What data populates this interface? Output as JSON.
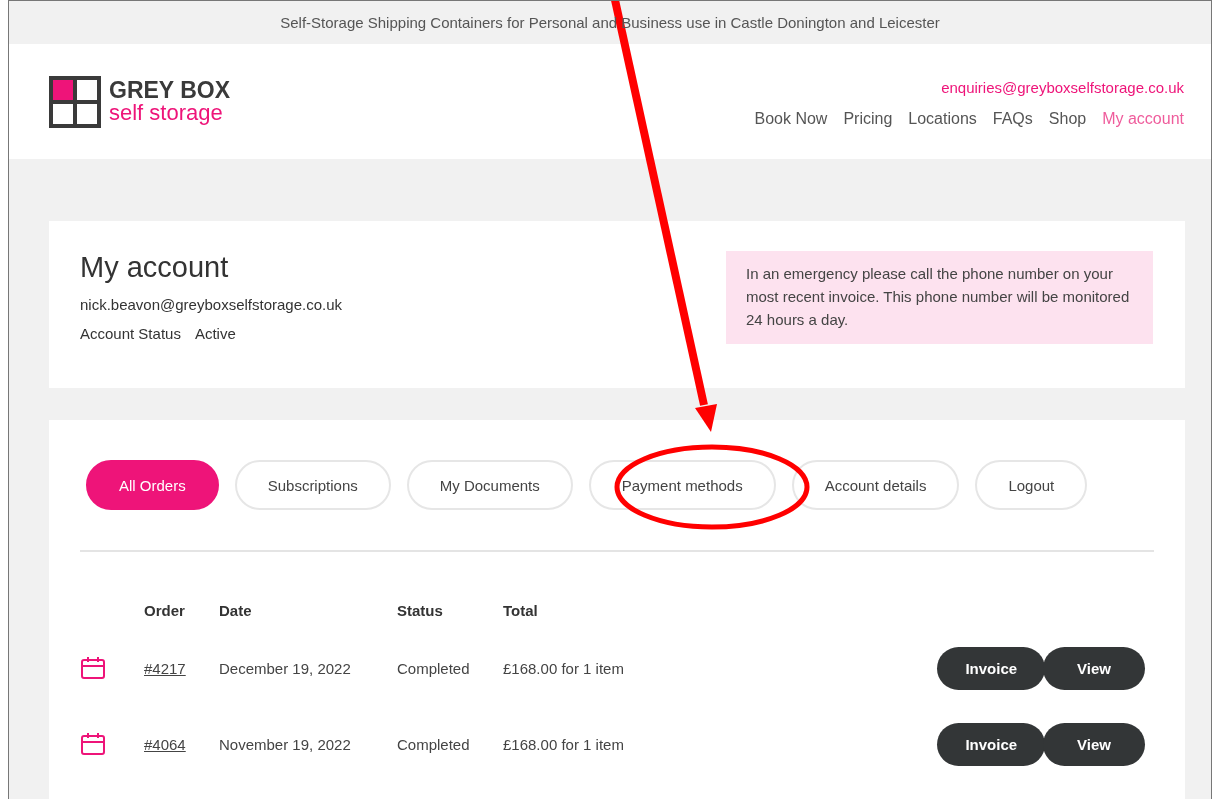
{
  "top_bar": {
    "tagline": "Self-Storage Shipping Containers for Personal and Business use in Castle Donington and Leicester"
  },
  "header": {
    "logo": {
      "line_1": "GREY BOX",
      "line_2": "self storage"
    },
    "email": "enquiries@greyboxselfstorage.co.uk",
    "nav": [
      {
        "label": "Book Now",
        "selected": false
      },
      {
        "label": "Pricing",
        "selected": false
      },
      {
        "label": "Locations",
        "selected": false
      },
      {
        "label": "FAQs",
        "selected": false
      },
      {
        "label": "Shop",
        "selected": false
      },
      {
        "label": "My account",
        "selected": true
      }
    ]
  },
  "account": {
    "title": "My account",
    "email": "nick.beavon@greyboxselfstorage.co.uk",
    "status_label": "Account Status",
    "status_value": "Active",
    "notice": "In an emergency please call the phone number on your most recent invoice. This phone number will be monitored 24 hours a day."
  },
  "tabs": [
    {
      "label": "All Orders",
      "selected": true
    },
    {
      "label": "Subscriptions",
      "selected": false
    },
    {
      "label": "My Documents",
      "selected": false
    },
    {
      "label": "Payment methods",
      "selected": false
    },
    {
      "label": "Account details",
      "selected": false
    },
    {
      "label": "Logout",
      "selected": false
    }
  ],
  "orders": {
    "columns": [
      "Order",
      "Date",
      "Status",
      "Total"
    ],
    "rows": [
      {
        "order": "#4217",
        "date": "December 19, 2022",
        "status": "Completed",
        "total": "£168.00 for 1 item",
        "actions": [
          "Invoice",
          "View"
        ]
      },
      {
        "order": "#4064",
        "date": "November 19, 2022",
        "status": "Completed",
        "total": "£168.00 for 1 item",
        "actions": [
          "Invoice",
          "View"
        ]
      }
    ]
  }
}
